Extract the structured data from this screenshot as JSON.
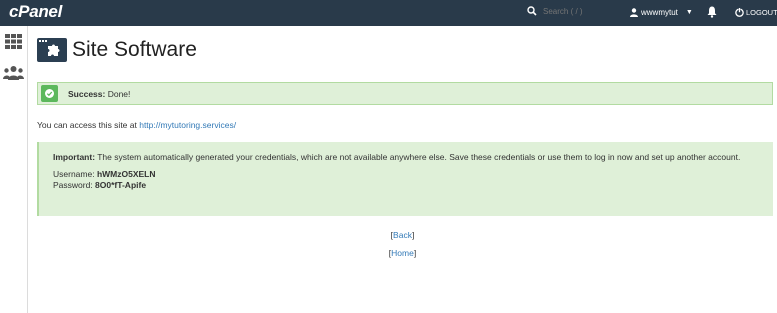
{
  "topbar": {
    "logo": "cPanel",
    "search_placeholder": "Search ( / )",
    "username": "wwwmytut",
    "logout_label": "LOGOUT"
  },
  "page": {
    "title": "Site Software"
  },
  "success": {
    "strong": "Success:",
    "text": " Done!"
  },
  "access": {
    "prefix": "You can access this site at ",
    "url": "http://mytutoring.services/"
  },
  "important": {
    "strong": "Important:",
    "text": " The system automatically generated your credentials, which are not available anywhere else. Save these credentials or use them to log in now and set up another account.",
    "username_label": "Username: ",
    "username_value": "hWMzO5XELN",
    "password_label": "Password: ",
    "password_value": "8O0*fT-Apife"
  },
  "links": {
    "back": "Back",
    "home": "Home"
  },
  "colors": {
    "topbar": "#293a4a",
    "success_bg": "#dff0d8",
    "success_border": "#b2dba1",
    "link": "#337ab7"
  }
}
